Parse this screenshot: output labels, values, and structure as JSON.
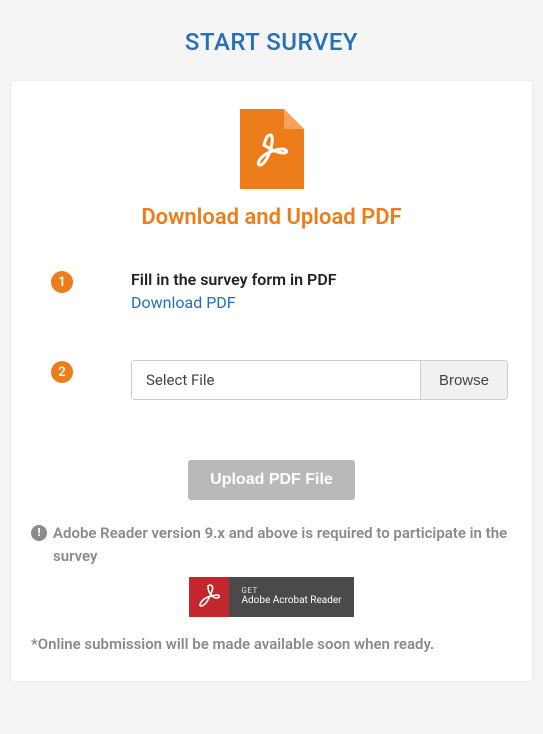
{
  "page": {
    "title": "START SURVEY"
  },
  "card": {
    "section_title": "Download and Upload PDF",
    "step1": {
      "num": "1",
      "text": "Fill in the survey form in PDF",
      "link": "Download PDF"
    },
    "step2": {
      "num": "2",
      "placeholder": "Select File",
      "browse": "Browse"
    },
    "upload_button": "Upload PDF File",
    "note": "Adobe Reader version 9.x and above is required to participate in the survey",
    "adobe": {
      "get": "GET",
      "name": "Adobe Acrobat Reader"
    },
    "footnote": "*Online submission will be made available soon when ready."
  }
}
